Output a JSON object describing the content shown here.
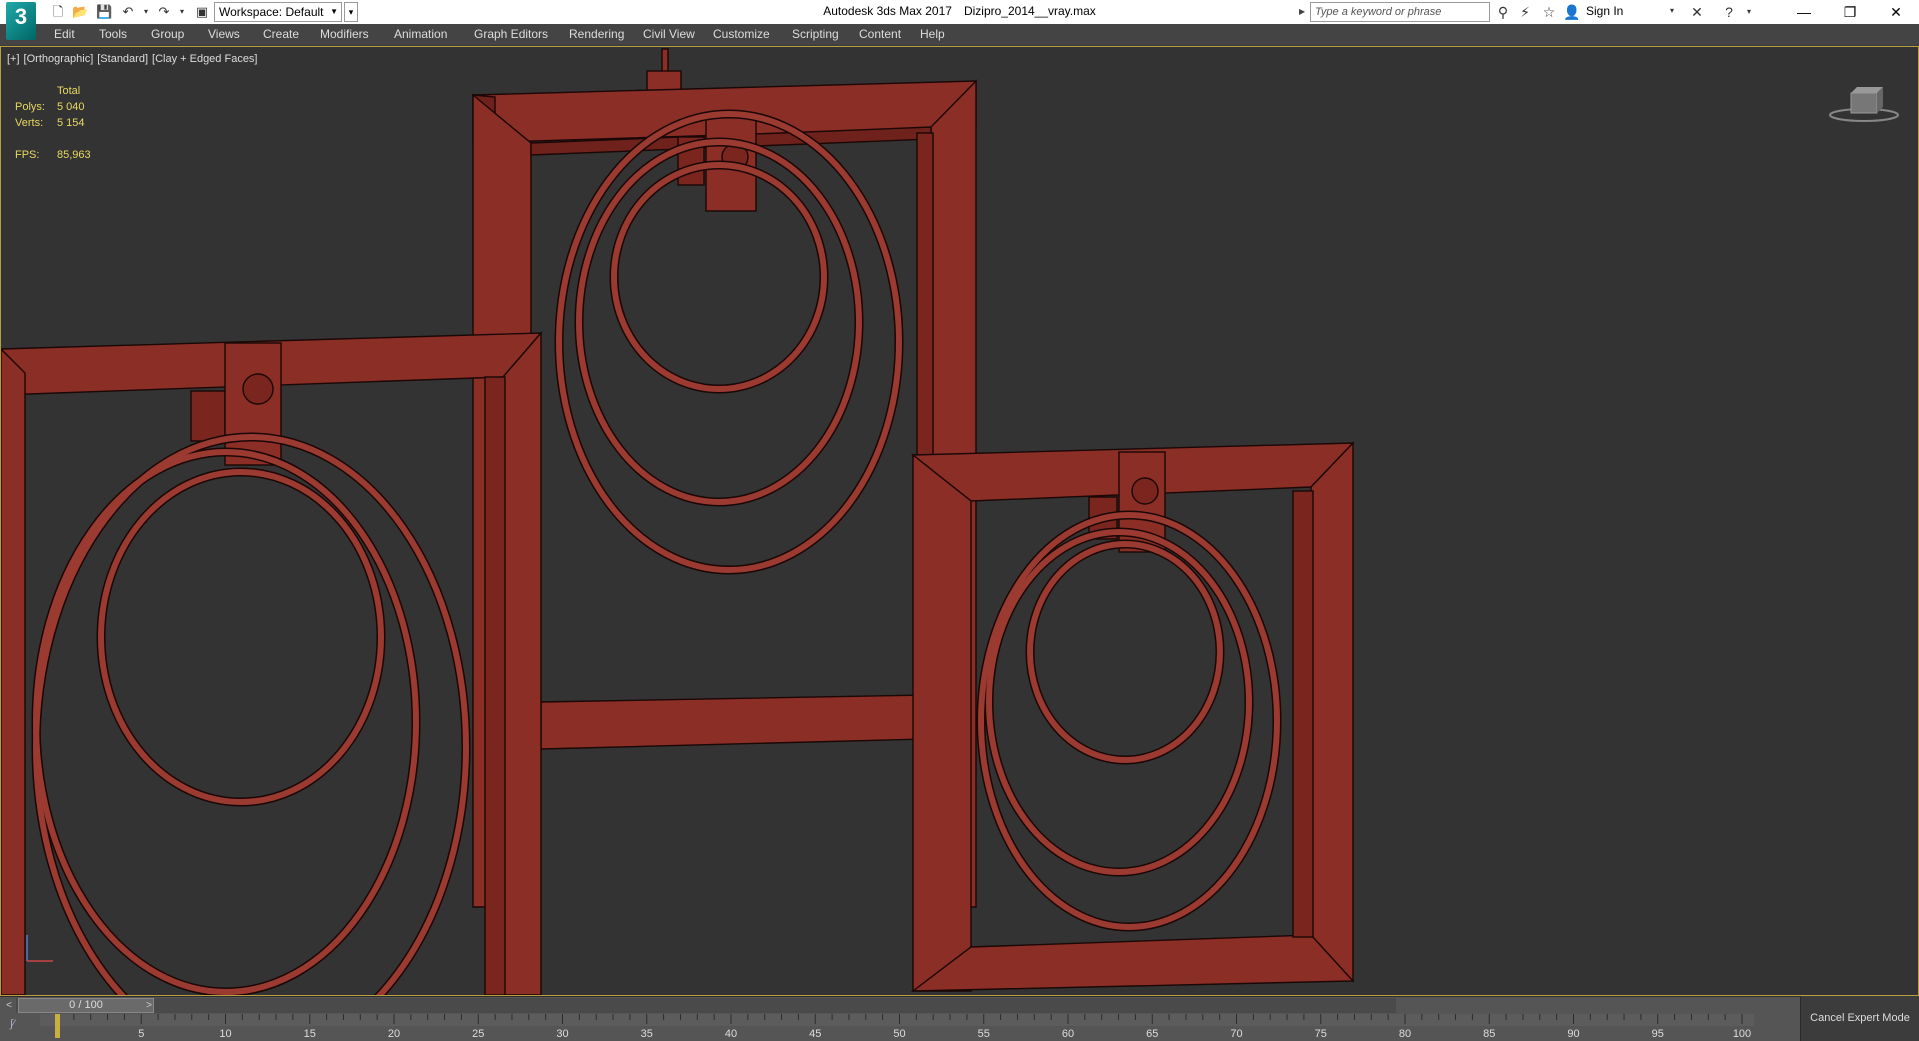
{
  "titlebar": {
    "logo_text": "3",
    "workspace": "Workspace: Default",
    "app_name": "Autodesk 3ds Max 2017",
    "file_name": "Dizipro_2014__vray.max",
    "search_placeholder": "Type a keyword or phrase",
    "sign_in": "Sign In"
  },
  "menu": {
    "items": [
      "Edit",
      "Tools",
      "Group",
      "Views",
      "Create",
      "Modifiers",
      "Animation",
      "Graph Editors",
      "Rendering",
      "Civil View",
      "Customize",
      "Scripting",
      "Content",
      "Help"
    ]
  },
  "viewport": {
    "label_plus": "[+]",
    "label_view": "[Orthographic]",
    "label_shading_std": "[Standard]",
    "label_shading": "[Clay + Edged Faces]",
    "stats": {
      "header": "Total",
      "polys_label": "Polys:",
      "polys": "5 040",
      "verts_label": "Verts:",
      "verts": "5 154",
      "fps_label": "FPS:",
      "fps": "85,963"
    },
    "object_color": "#8b2e26",
    "background_color": "#333333"
  },
  "timeline": {
    "frame_display": "0 / 100",
    "prev": "<",
    "next": ">",
    "ticks": [
      "5",
      "10",
      "15",
      "20",
      "25",
      "30",
      "35",
      "40",
      "45",
      "50",
      "55",
      "60",
      "65",
      "70",
      "75",
      "80",
      "85",
      "90",
      "95",
      "100"
    ],
    "cancel_expert": "Cancel Expert Mode"
  }
}
